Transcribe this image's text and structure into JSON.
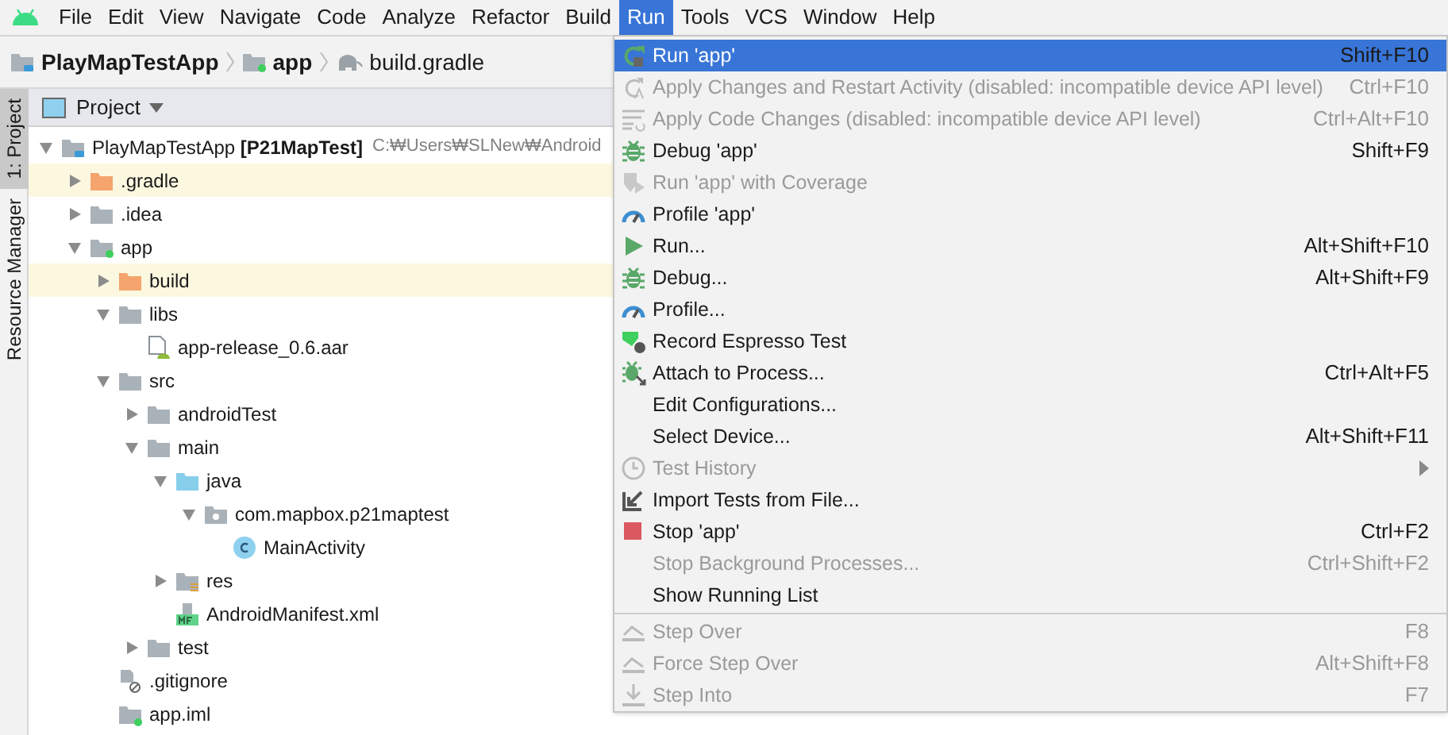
{
  "menu_bar": [
    {
      "label": "File",
      "selected": false
    },
    {
      "label": "Edit",
      "selected": false
    },
    {
      "label": "View",
      "selected": false
    },
    {
      "label": "Navigate",
      "selected": false
    },
    {
      "label": "Code",
      "selected": false
    },
    {
      "label": "Analyze",
      "selected": false
    },
    {
      "label": "Refactor",
      "selected": false
    },
    {
      "label": "Build",
      "selected": false
    },
    {
      "label": "Run",
      "selected": true
    },
    {
      "label": "Tools",
      "selected": false
    },
    {
      "label": "VCS",
      "selected": false
    },
    {
      "label": "Window",
      "selected": false
    },
    {
      "label": "Help",
      "selected": false
    }
  ],
  "breadcrumb": [
    {
      "label": "PlayMapTestApp",
      "kind": "project"
    },
    {
      "label": "app",
      "kind": "module"
    },
    {
      "label": "build.gradle",
      "kind": "gradle"
    }
  ],
  "side_tabs": [
    {
      "label": "1: Project",
      "selected": true
    },
    {
      "label": "Resource Manager",
      "selected": false
    }
  ],
  "project_panel": {
    "title": "Project",
    "tree": [
      {
        "label": "PlayMapTestApp **[P21MapTest]**",
        "path": "C:₩Users₩SLNew₩Android",
        "kind": "project",
        "expanded": true,
        "children": [
          {
            "label": ".gradle",
            "kind": "excluded",
            "expanded": false
          },
          {
            "label": ".idea",
            "kind": "folder",
            "expanded": false
          },
          {
            "label": "app",
            "kind": "module",
            "expanded": true,
            "children": [
              {
                "label": "build",
                "kind": "excluded",
                "expanded": false
              },
              {
                "label": "libs",
                "kind": "folder",
                "expanded": true,
                "children": [
                  {
                    "label": "app-release_0.6.aar",
                    "kind": "aar"
                  }
                ]
              },
              {
                "label": "src",
                "kind": "folder",
                "expanded": true,
                "children": [
                  {
                    "label": "androidTest",
                    "kind": "folder",
                    "expanded": false
                  },
                  {
                    "label": "main",
                    "kind": "folder",
                    "expanded": true,
                    "children": [
                      {
                        "label": "java",
                        "kind": "source",
                        "expanded": true,
                        "children": [
                          {
                            "label": "com.mapbox.p21maptest",
                            "kind": "package",
                            "expanded": true,
                            "children": [
                              {
                                "label": "MainActivity",
                                "kind": "class"
                              }
                            ]
                          }
                        ]
                      },
                      {
                        "label": "res",
                        "kind": "res",
                        "expanded": false
                      },
                      {
                        "label": "AndroidManifest.xml",
                        "kind": "manifest"
                      }
                    ]
                  },
                  {
                    "label": "test",
                    "kind": "folder",
                    "expanded": false
                  }
                ]
              },
              {
                "label": ".gitignore",
                "kind": "ignore"
              },
              {
                "label": "app.iml",
                "kind": "iml"
              }
            ]
          }
        ]
      }
    ]
  },
  "run_menu": [
    {
      "kind": "rerun",
      "label": "Run 'app'",
      "shortcut": "Shift+F10",
      "selected": true,
      "disabled": false,
      "submenu": false
    },
    {
      "kind": "apply",
      "label": "Apply Changes and Restart Activity (disabled: incompatible device API level)",
      "shortcut": "Ctrl+F10",
      "selected": false,
      "disabled": true,
      "submenu": false
    },
    {
      "kind": "code",
      "label": "Apply Code Changes (disabled: incompatible device API level)",
      "shortcut": "Ctrl+Alt+F10",
      "selected": false,
      "disabled": true,
      "submenu": false
    },
    {
      "kind": "bug",
      "label": "Debug 'app'",
      "shortcut": "Shift+F9",
      "selected": false,
      "disabled": false,
      "submenu": false
    },
    {
      "kind": "coverage",
      "label": "Run 'app' with Coverage",
      "selected": false,
      "disabled": true,
      "submenu": false
    },
    {
      "kind": "profile",
      "label": "Profile 'app'",
      "selected": false,
      "disabled": false,
      "submenu": false
    },
    {
      "kind": "play",
      "label": "Run...",
      "shortcut": "Alt+Shift+F10",
      "selected": false,
      "disabled": false,
      "submenu": false
    },
    {
      "kind": "bug",
      "label": "Debug...",
      "shortcut": "Alt+Shift+F9",
      "selected": false,
      "disabled": false,
      "submenu": false
    },
    {
      "kind": "profile",
      "label": "Profile...",
      "selected": false,
      "disabled": false,
      "submenu": false
    },
    {
      "kind": "record",
      "label": "Record Espresso Test",
      "selected": false,
      "disabled": false,
      "submenu": false
    },
    {
      "kind": "attach",
      "label": "Attach to Process...",
      "shortcut": "Ctrl+Alt+F5",
      "selected": false,
      "disabled": false,
      "submenu": false
    },
    {
      "kind": "plain",
      "label": "Edit Configurations...",
      "selected": false,
      "disabled": false,
      "submenu": false
    },
    {
      "kind": "plain",
      "label": "Select Device...",
      "shortcut": "Alt+Shift+F11",
      "selected": false,
      "disabled": false,
      "submenu": false
    },
    {
      "kind": "history",
      "label": "Test History",
      "selected": false,
      "disabled": true,
      "submenu": true
    },
    {
      "kind": "import",
      "label": "Import Tests from File...",
      "selected": false,
      "disabled": false,
      "submenu": false
    },
    {
      "kind": "stop",
      "label": "Stop 'app'",
      "shortcut": "Ctrl+F2",
      "selected": false,
      "disabled": false,
      "submenu": false
    },
    {
      "kind": "plain",
      "label": "Stop Background Processes...",
      "shortcut": "Ctrl+Shift+F2",
      "selected": false,
      "disabled": true,
      "submenu": false
    },
    {
      "kind": "plain",
      "label": "Show Running List",
      "selected": false,
      "disabled": false,
      "submenu": false
    },
    {
      "kind": "separator"
    },
    {
      "kind": "stepover",
      "label": "Step Over",
      "shortcut": "F8",
      "selected": false,
      "disabled": true,
      "submenu": false
    },
    {
      "kind": "stepover",
      "label": "Force Step Over",
      "shortcut": "Alt+Shift+F8",
      "selected": false,
      "disabled": true,
      "submenu": false
    },
    {
      "kind": "stepinto",
      "label": "Step Into",
      "shortcut": "F7",
      "selected": false,
      "disabled": true,
      "submenu": false
    }
  ]
}
